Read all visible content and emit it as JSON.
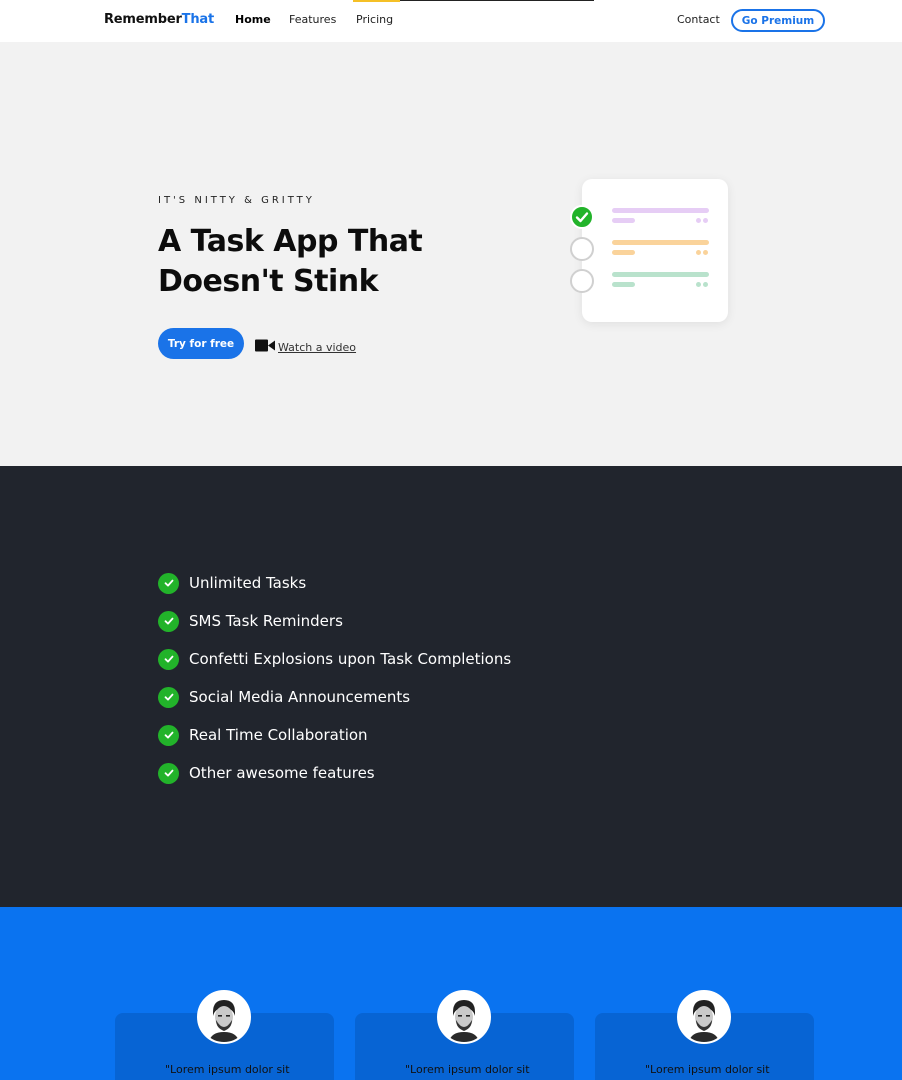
{
  "nav": {
    "logo_main": "Remember",
    "logo_accent": "That",
    "links": [
      "Home",
      "Features",
      "Pricing"
    ],
    "contact": "Contact",
    "premium": "Go Premium"
  },
  "hero": {
    "eyebrow": "IT'S NITTY & GRITTY",
    "title_line1": "A Task App That",
    "title_line2": "Doesn't Stink",
    "cta": "Try for free",
    "video_link": "Watch a video"
  },
  "features": [
    "Unlimited Tasks",
    "SMS Task Reminders",
    "Confetti Explosions upon Task Completions",
    "Social Media Announcements",
    "Real Time Collaboration",
    "Other awesome features"
  ],
  "testimonials": [
    {
      "quote": "\"Lorem ipsum dolor sit"
    },
    {
      "quote": "\"Lorem ipsum dolor sit"
    },
    {
      "quote": "\"Lorem ipsum dolor sit"
    }
  ],
  "colors": {
    "brand_blue": "#1a73e8",
    "check_green": "#22b32a",
    "dark_bg": "#21252d",
    "hero_bg": "#f2f2f2",
    "testimonial_bg": "#0a73f0"
  },
  "icons": [
    "video-camera-icon",
    "check-icon",
    "avatar-image"
  ]
}
